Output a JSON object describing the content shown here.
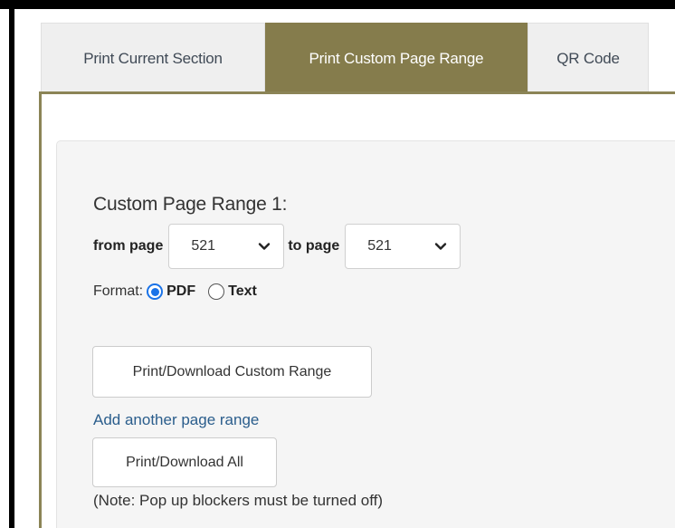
{
  "tabs": [
    {
      "label": "Print Current Section",
      "active": false
    },
    {
      "label": "Print Custom Page Range",
      "active": true
    },
    {
      "label": "QR Code",
      "active": false
    }
  ],
  "range": {
    "title": "Custom Page Range 1:",
    "from_label": "from page",
    "from_value": "521",
    "to_label": "to page",
    "to_value": "521"
  },
  "format": {
    "label": "Format:",
    "options": [
      {
        "label": "PDF",
        "checked": true
      },
      {
        "label": "Text",
        "checked": false
      }
    ]
  },
  "actions": {
    "print_range_label": "Print/Download Custom Range",
    "add_range_label": "Add another page range",
    "print_all_label": "Print/Download All",
    "note": "(Note: Pop up blockers must be turned off)"
  },
  "colors": {
    "active_tab": "#857c4c",
    "panel_border": "#8b8456",
    "link": "#2a5d8c",
    "radio_accent": "#1a73e8"
  }
}
